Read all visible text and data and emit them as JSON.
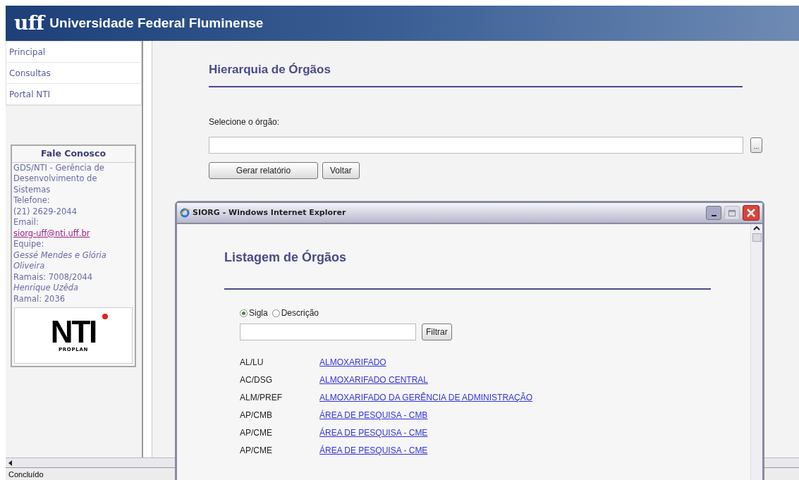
{
  "header": {
    "logo": "uff",
    "title": "Universidade Federal Fluminense"
  },
  "sidebar": {
    "menu": [
      {
        "label": "Principal"
      },
      {
        "label": "Consultas"
      },
      {
        "label": "Portal NTI"
      }
    ],
    "contact": {
      "title": "Fale Conosco",
      "lines": [
        {
          "kind": "text",
          "text": "GDS/NTI - Gerência de Desenvolvimento de Sistemas"
        },
        {
          "kind": "text",
          "text": "Telefone:"
        },
        {
          "kind": "text",
          "text": "(21) 2629-2044"
        },
        {
          "kind": "text",
          "text": "Email:"
        },
        {
          "kind": "link",
          "text": "siorg-uff@nti.uff.br"
        },
        {
          "kind": "text",
          "text": "Equipe:"
        },
        {
          "kind": "italic",
          "text": "Gessé Mendes e Glória Oliveira"
        },
        {
          "kind": "text",
          "text": "Ramais: 7008/2044"
        },
        {
          "kind": "italic",
          "text": "Henrique Uzêda"
        },
        {
          "kind": "text",
          "text": "Ramal: 2036"
        }
      ],
      "logo": {
        "mark": "NTI",
        "sub": "PROPLAN"
      }
    }
  },
  "main": {
    "heading": "Hierarquia de Órgãos",
    "field_label": "Selecione o órgão:",
    "browse_button": "...",
    "buttons": [
      "Gerar relatório",
      "Voltar"
    ]
  },
  "popup": {
    "title": "SIORG - Windows Internet Explorer",
    "heading": "Listagem de Órgãos",
    "radios": [
      {
        "label": "Sigla",
        "selected": true
      },
      {
        "label": "Descrição",
        "selected": false
      }
    ],
    "filter_button": "Filtrar",
    "rows": [
      {
        "code": "AL/LU",
        "name": "ALMOXARIFADO"
      },
      {
        "code": "AC/DSG",
        "name": "ALMOXARIFADO CENTRAL"
      },
      {
        "code": "ALM/PREF",
        "name": "ALMOXARIFADO DA GERÊNCIA DE ADMINISTRAÇÃO"
      },
      {
        "code": "AP/CMB",
        "name": "ÁREA DE PESQUISA - CMB"
      },
      {
        "code": "AP/CME",
        "name": "ÁREA DE PESQUISA - CME"
      },
      {
        "code": "AP/CME",
        "name": "ÁREA DE PESQUISA - CME"
      }
    ]
  },
  "status_bar": {
    "text": "Concluído"
  }
}
